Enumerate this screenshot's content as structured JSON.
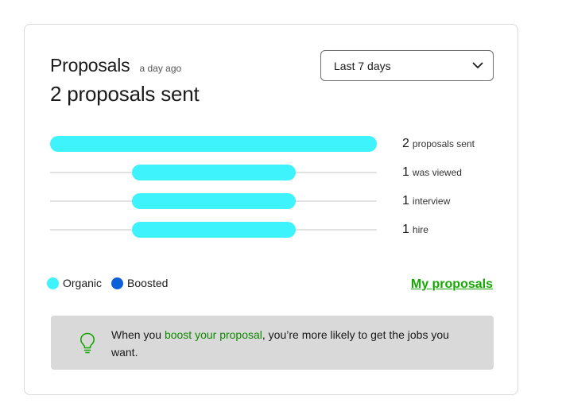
{
  "card": {
    "title": "Proposals",
    "timestamp": "a day ago",
    "headline": "2 proposals sent",
    "period_select": {
      "selected": "Last 7 days",
      "icon": "chevron-down-icon"
    }
  },
  "funnel": {
    "max": 2,
    "rows": [
      {
        "count": "2",
        "label": "proposals sent",
        "organic": 2,
        "boosted": 0
      },
      {
        "count": "1",
        "label": "was viewed",
        "organic": 1,
        "boosted": 0
      },
      {
        "count": "1",
        "label": "interview",
        "organic": 1,
        "boosted": 0
      },
      {
        "count": "1",
        "label": "hire",
        "organic": 1,
        "boosted": 0
      }
    ]
  },
  "legend": {
    "organic": "Organic",
    "boosted": "Boosted"
  },
  "links": {
    "my_proposals": "My proposals"
  },
  "tip": {
    "icon": "lightbulb-icon",
    "before": "When you ",
    "link": "boost your proposal",
    "after": ", you’re more likely to get the jobs you want."
  },
  "colors": {
    "organic": "#3ef3fb",
    "boosted": "#0d5fd9",
    "link_green": "#14a800",
    "tip_background": "#d9d9d9"
  }
}
